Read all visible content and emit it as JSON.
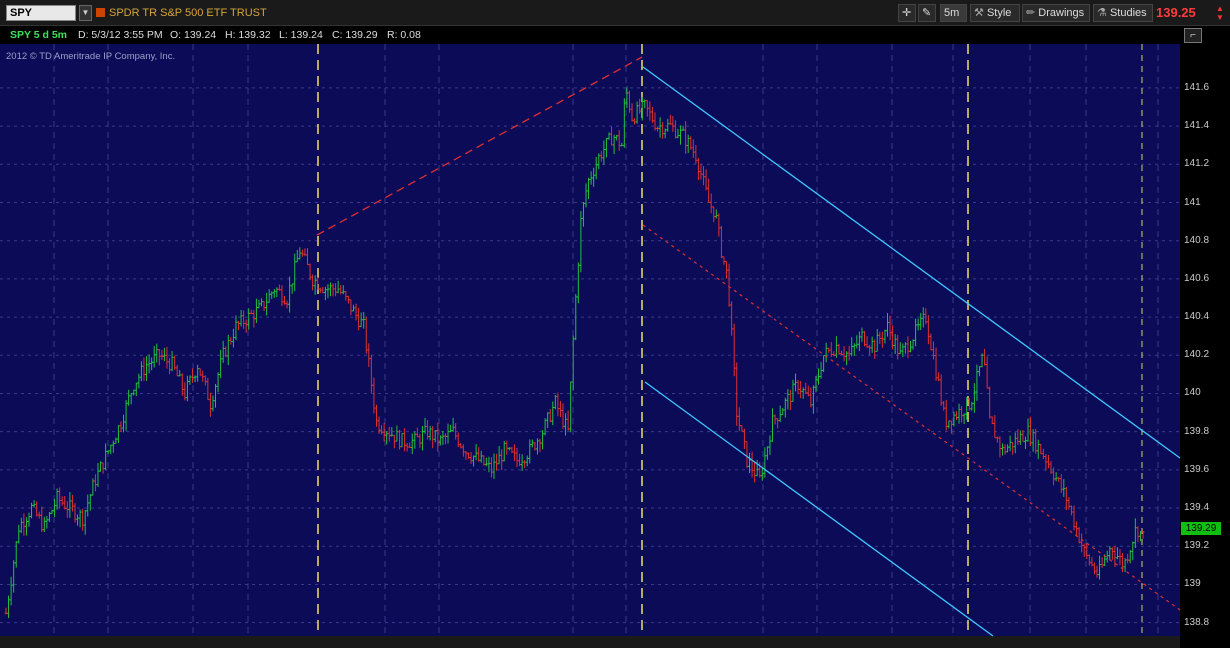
{
  "toolbar": {
    "symbol": "SPY",
    "description": "SPDR TR S&P 500 ETF TRUST",
    "timeframe_button": "5m",
    "style_button": "Style",
    "drawings_button": "Drawings",
    "studies_button": "Studies",
    "last_price": "139.25"
  },
  "infobar": {
    "chart_id": "SPY 5 d 5m",
    "date": "D: 5/3/12 3:55 PM",
    "open": "O: 139.24",
    "high": "H: 139.32",
    "low": "L: 139.24",
    "close": "C: 139.29",
    "range": "R: 0.08"
  },
  "copyright": "2012 © TD Ameritrade IP Company, Inc.",
  "colors": {
    "plot_background": "#0b0b58",
    "up_bar": "#22c040",
    "down_bar": "#e03030",
    "channel_line": "#40c8ff",
    "dashed_line": "#e03030",
    "session_marker": "#f0e060",
    "price_tag": "#10c010"
  },
  "chart_data": {
    "type": "line",
    "y_tick_labels": [
      "141.6",
      "141.4",
      "141.2",
      "141",
      "140.8",
      "140.6",
      "140.4",
      "140.2",
      "140",
      "139.8",
      "139.6",
      "139.4",
      "139.2",
      "139",
      "138.8"
    ],
    "ylim": [
      138.73,
      141.83
    ],
    "current_price_label": "139.29",
    "x_bars": 391,
    "price_path": [
      [
        0,
        138.85
      ],
      [
        10,
        139.3
      ],
      [
        20,
        139.4
      ],
      [
        30,
        139.3
      ],
      [
        40,
        139.45
      ],
      [
        50,
        139.4
      ],
      [
        60,
        139.35
      ],
      [
        70,
        139.55
      ],
      [
        80,
        139.7
      ],
      [
        90,
        139.85
      ],
      [
        100,
        140.05
      ],
      [
        110,
        140.15
      ],
      [
        120,
        140.2
      ],
      [
        130,
        140.15
      ],
      [
        140,
        140.0
      ],
      [
        150,
        140.15
      ],
      [
        160,
        139.95
      ],
      [
        170,
        140.2
      ],
      [
        180,
        140.35
      ],
      [
        190,
        140.4
      ],
      [
        200,
        140.45
      ],
      [
        210,
        140.55
      ],
      [
        220,
        140.5
      ],
      [
        230,
        140.75
      ],
      [
        240,
        140.6
      ],
      [
        250,
        140.55
      ],
      [
        260,
        140.55
      ],
      [
        270,
        140.45
      ],
      [
        280,
        140.35
      ],
      [
        290,
        139.85
      ],
      [
        300,
        139.8
      ],
      [
        310,
        139.75
      ],
      [
        320,
        139.75
      ],
      [
        330,
        139.8
      ],
      [
        340,
        139.75
      ],
      [
        350,
        139.8
      ],
      [
        360,
        139.7
      ],
      [
        370,
        139.65
      ],
      [
        380,
        139.6
      ],
      [
        390,
        139.7
      ],
      [
        400,
        139.65
      ],
      [
        410,
        139.7
      ],
      [
        420,
        139.8
      ],
      [
        430,
        139.95
      ],
      [
        440,
        139.8
      ],
      [
        445,
        140.4
      ],
      [
        450,
        140.9
      ],
      [
        455,
        141.1
      ],
      [
        465,
        141.25
      ],
      [
        475,
        141.35
      ],
      [
        482,
        141.3
      ],
      [
        485,
        141.6
      ],
      [
        490,
        141.45
      ],
      [
        500,
        141.5
      ],
      [
        510,
        141.4
      ],
      [
        520,
        141.4
      ],
      [
        530,
        141.35
      ],
      [
        540,
        141.25
      ],
      [
        550,
        141.0
      ],
      [
        555,
        140.95
      ],
      [
        560,
        140.75
      ],
      [
        565,
        140.6
      ],
      [
        572,
        139.9
      ],
      [
        580,
        139.65
      ],
      [
        590,
        139.55
      ],
      [
        600,
        139.85
      ],
      [
        610,
        139.95
      ],
      [
        620,
        140.05
      ],
      [
        630,
        139.95
      ],
      [
        640,
        140.2
      ],
      [
        650,
        140.25
      ],
      [
        660,
        140.2
      ],
      [
        670,
        140.3
      ],
      [
        680,
        140.25
      ],
      [
        690,
        140.35
      ],
      [
        700,
        140.2
      ],
      [
        710,
        140.3
      ],
      [
        720,
        140.4
      ],
      [
        730,
        140.05
      ],
      [
        735,
        139.85
      ],
      [
        745,
        139.9
      ],
      [
        755,
        139.95
      ],
      [
        765,
        140.2
      ],
      [
        770,
        139.85
      ],
      [
        780,
        139.7
      ],
      [
        790,
        139.75
      ],
      [
        800,
        139.8
      ],
      [
        815,
        139.65
      ],
      [
        830,
        139.45
      ],
      [
        845,
        139.15
      ],
      [
        855,
        139.05
      ],
      [
        865,
        139.2
      ],
      [
        875,
        139.1
      ],
      [
        885,
        139.3
      ],
      [
        890,
        139.25
      ]
    ]
  }
}
